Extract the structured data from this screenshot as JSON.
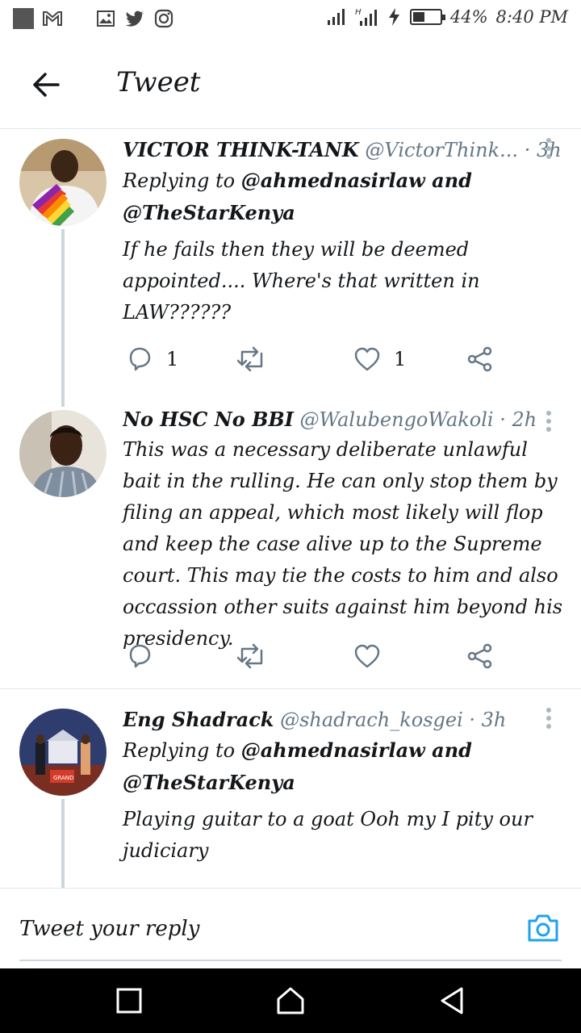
{
  "status_bar": {
    "battery": "44%",
    "battery_level": 0.44,
    "time": "8:40 PM",
    "icons": [
      "notification-square-icon",
      "gmail-icon",
      "gallery-icon",
      "twitter-icon",
      "instagram-icon",
      "signal-icon",
      "signal-h-icon",
      "charging-icon",
      "battery-icon"
    ]
  },
  "header": {
    "title": "Tweet"
  },
  "tweets": [
    {
      "name": "VICTOR THINK-TANK",
      "handle": "@VictorThink...",
      "time": "· 3h",
      "replying_prefix": "Replying to",
      "replying_mentions": "@ahmednasirlaw and",
      "replying_mentions_2": "@TheStarKenya",
      "text": "If he fails then they will be deemed appointed.... Where's that written in LAW??????",
      "reply_count": "1",
      "retweet_count": "",
      "like_count": "1"
    },
    {
      "name": "No HSC No BBI",
      "handle": "@WalubengoWakoli",
      "time": "· 2h",
      "text": "This was a necessary deliberate unlawful bait in the rulling. He can only stop them by filing an appeal, which most likely will flop and keep the case alive up to the Supreme court. This may tie the costs to him and also occassion other suits against him beyond his presidency.",
      "reply_count": "",
      "retweet_count": "",
      "like_count": ""
    },
    {
      "name": "Eng Shadrack",
      "handle": "@shadrach_kosgei",
      "time": "· 3h",
      "replying_prefix": "Replying to",
      "replying_mentions": "@ahmednasirlaw and",
      "replying_mentions_2": "@TheStarKenya",
      "text": "Playing guitar to a goat Ooh my I pity our judiciary"
    }
  ],
  "reply_bar": {
    "placeholder": "Tweet your reply"
  },
  "colors": {
    "accent": "#1da1f2",
    "text": "#14171a",
    "muted": "#657786",
    "divider": "#e1e8ed",
    "thread": "#ccd6dd"
  }
}
